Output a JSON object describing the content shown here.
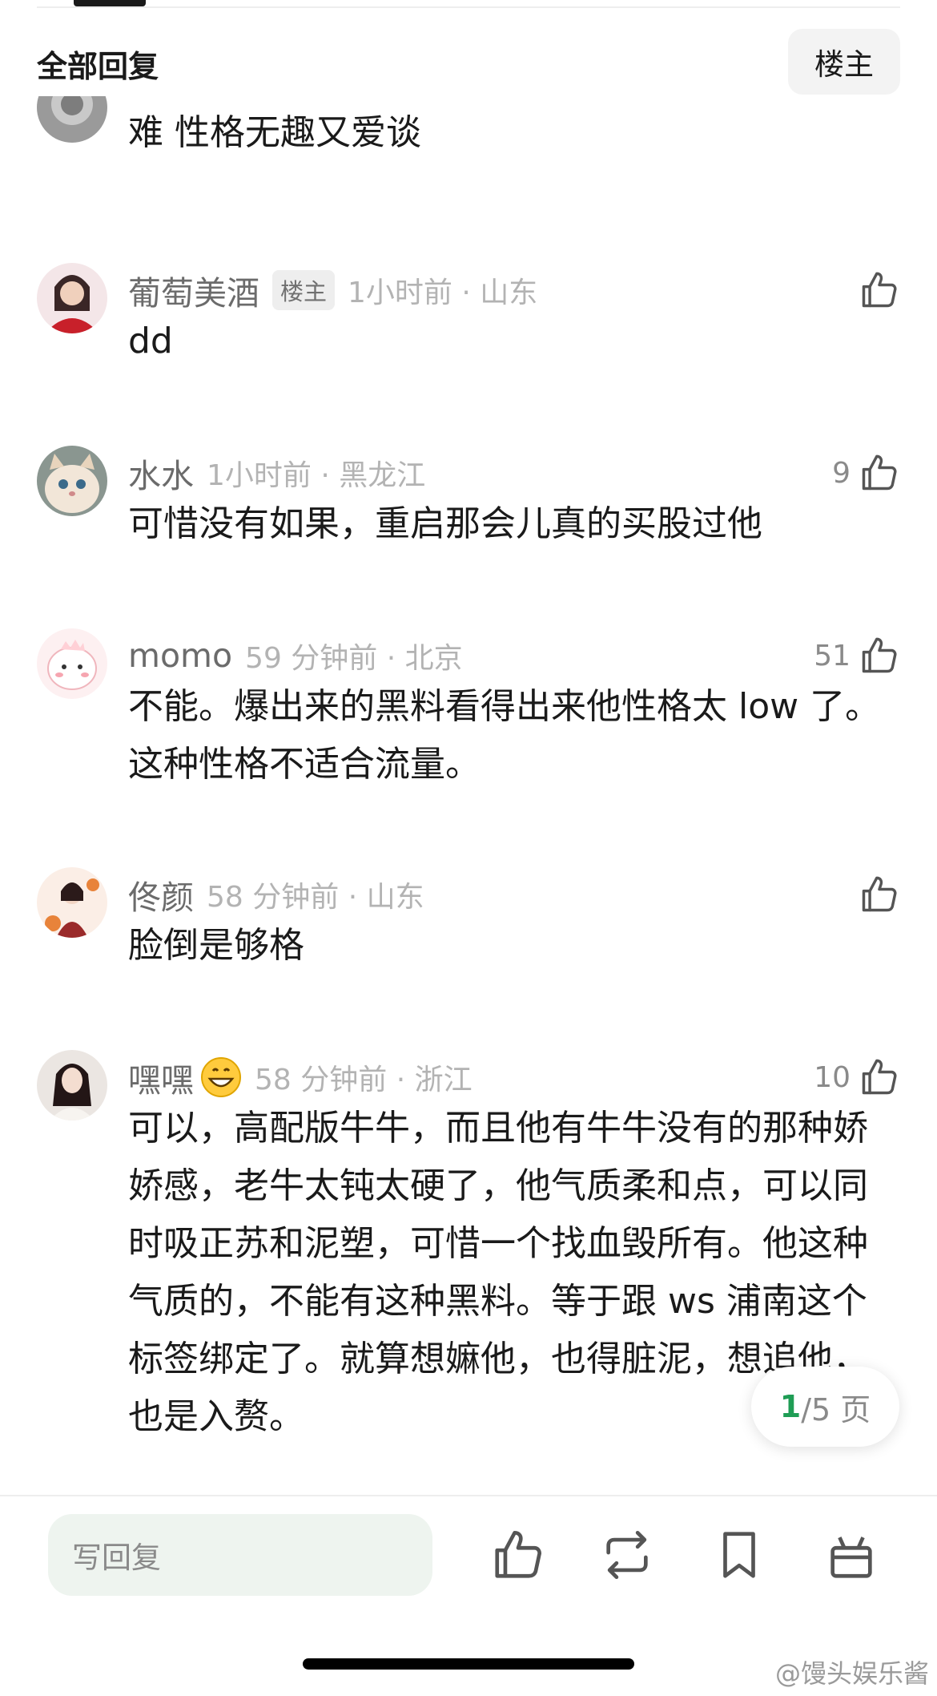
{
  "header": {
    "title": "全部回复",
    "op_button_label": "楼主"
  },
  "comments": [
    {
      "username": "",
      "op_tag": "",
      "time_loc": "",
      "likes": "",
      "content": "难 性格无趣又爱谈"
    },
    {
      "username": "葡萄美酒",
      "op_tag": "楼主",
      "time_loc": "1小时前 · 山东",
      "likes": "",
      "content": "dd"
    },
    {
      "username": "水水",
      "op_tag": "",
      "time_loc": "1小时前 · 黑龙江",
      "likes": "9",
      "content": "可惜没有如果，重启那会儿真的买股过他"
    },
    {
      "username": "momo",
      "op_tag": "",
      "time_loc": "59 分钟前 · 北京",
      "likes": "51",
      "content": "不能。爆出来的黑料看得出来他性格太 low 了。这种性格不适合流量。"
    },
    {
      "username": "佟颜",
      "op_tag": "",
      "time_loc": "58 分钟前 · 山东",
      "likes": "",
      "content": "脸倒是够格"
    },
    {
      "username": "嘿嘿",
      "op_tag": "",
      "time_loc": "58 分钟前 · 浙江",
      "likes": "10",
      "content": "可以，高配版牛牛，而且他有牛牛没有的那种娇娇感，老牛太钝太硬了，他气质柔和点，可以同时吸正苏和泥塑，可惜一个找血毁所有。他这种气质的，不能有这种黑料。等于跟 ws 浦南这个标签绑定了。就算想嫲他，也得脏泥，想追他，也是入赘。"
    }
  ],
  "pagination": {
    "current": "1",
    "total_label": "/5 页"
  },
  "bottom_bar": {
    "reply_placeholder": "写回复"
  },
  "watermark": "@馒头娱乐酱",
  "colors": {
    "accent_green": "#1f9d55",
    "reply_bg": "#eef4ef"
  }
}
